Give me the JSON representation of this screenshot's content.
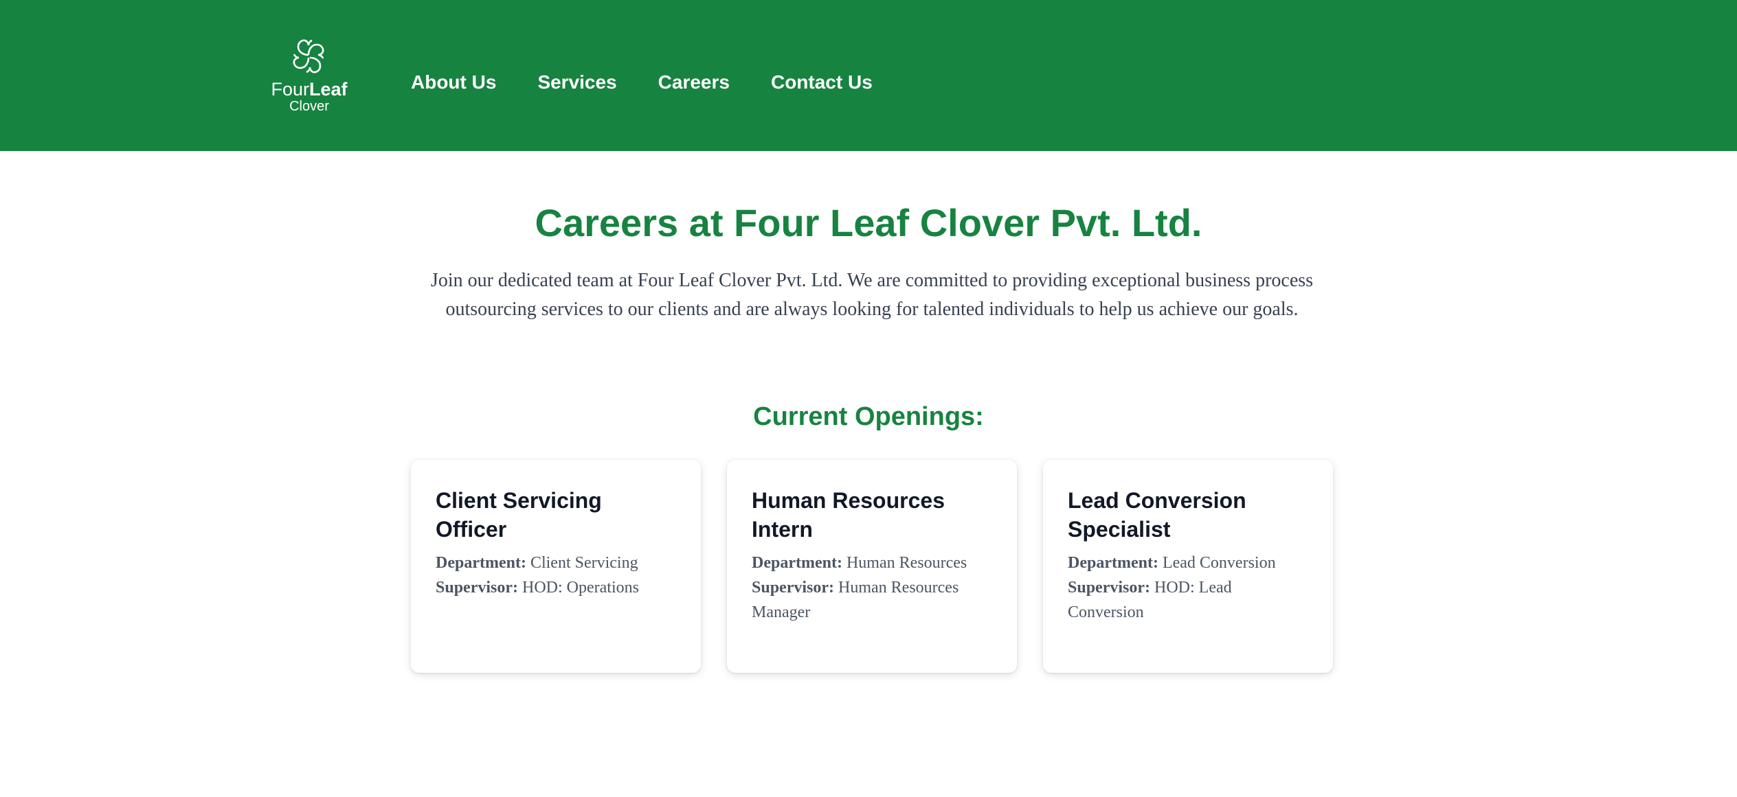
{
  "brand": {
    "logo_line1_light": "Four",
    "logo_line1_bold": "Leaf",
    "logo_line2": "Clover",
    "logo_icon": "four-leaf-clover-icon",
    "header_color": "#178340"
  },
  "nav": {
    "items": [
      {
        "label": "About Us"
      },
      {
        "label": "Services"
      },
      {
        "label": "Careers"
      },
      {
        "label": "Contact Us"
      }
    ]
  },
  "main": {
    "title": "Careers at Four Leaf Clover Pvt. Ltd.",
    "intro": "Join our dedicated team at Four Leaf Clover Pvt. Ltd. We are committed to providing exceptional business process outsourcing services to our clients and are always looking for talented individuals to help us achieve our goals.",
    "openings_title": "Current Openings:",
    "jobs": [
      {
        "title": "Client Servicing Officer",
        "department_label": "Department:",
        "department": "Client Servicing",
        "supervisor_label": "Supervisor:",
        "supervisor": "HOD: Operations"
      },
      {
        "title": "Human Resources Intern",
        "department_label": "Department:",
        "department": "Human Resources",
        "supervisor_label": "Supervisor:",
        "supervisor": "Human Resources Manager"
      },
      {
        "title": "Lead Conversion Specialist",
        "department_label": "Department:",
        "department": "Lead Conversion",
        "supervisor_label": "Supervisor:",
        "supervisor": "HOD: Lead Conversion"
      }
    ]
  }
}
